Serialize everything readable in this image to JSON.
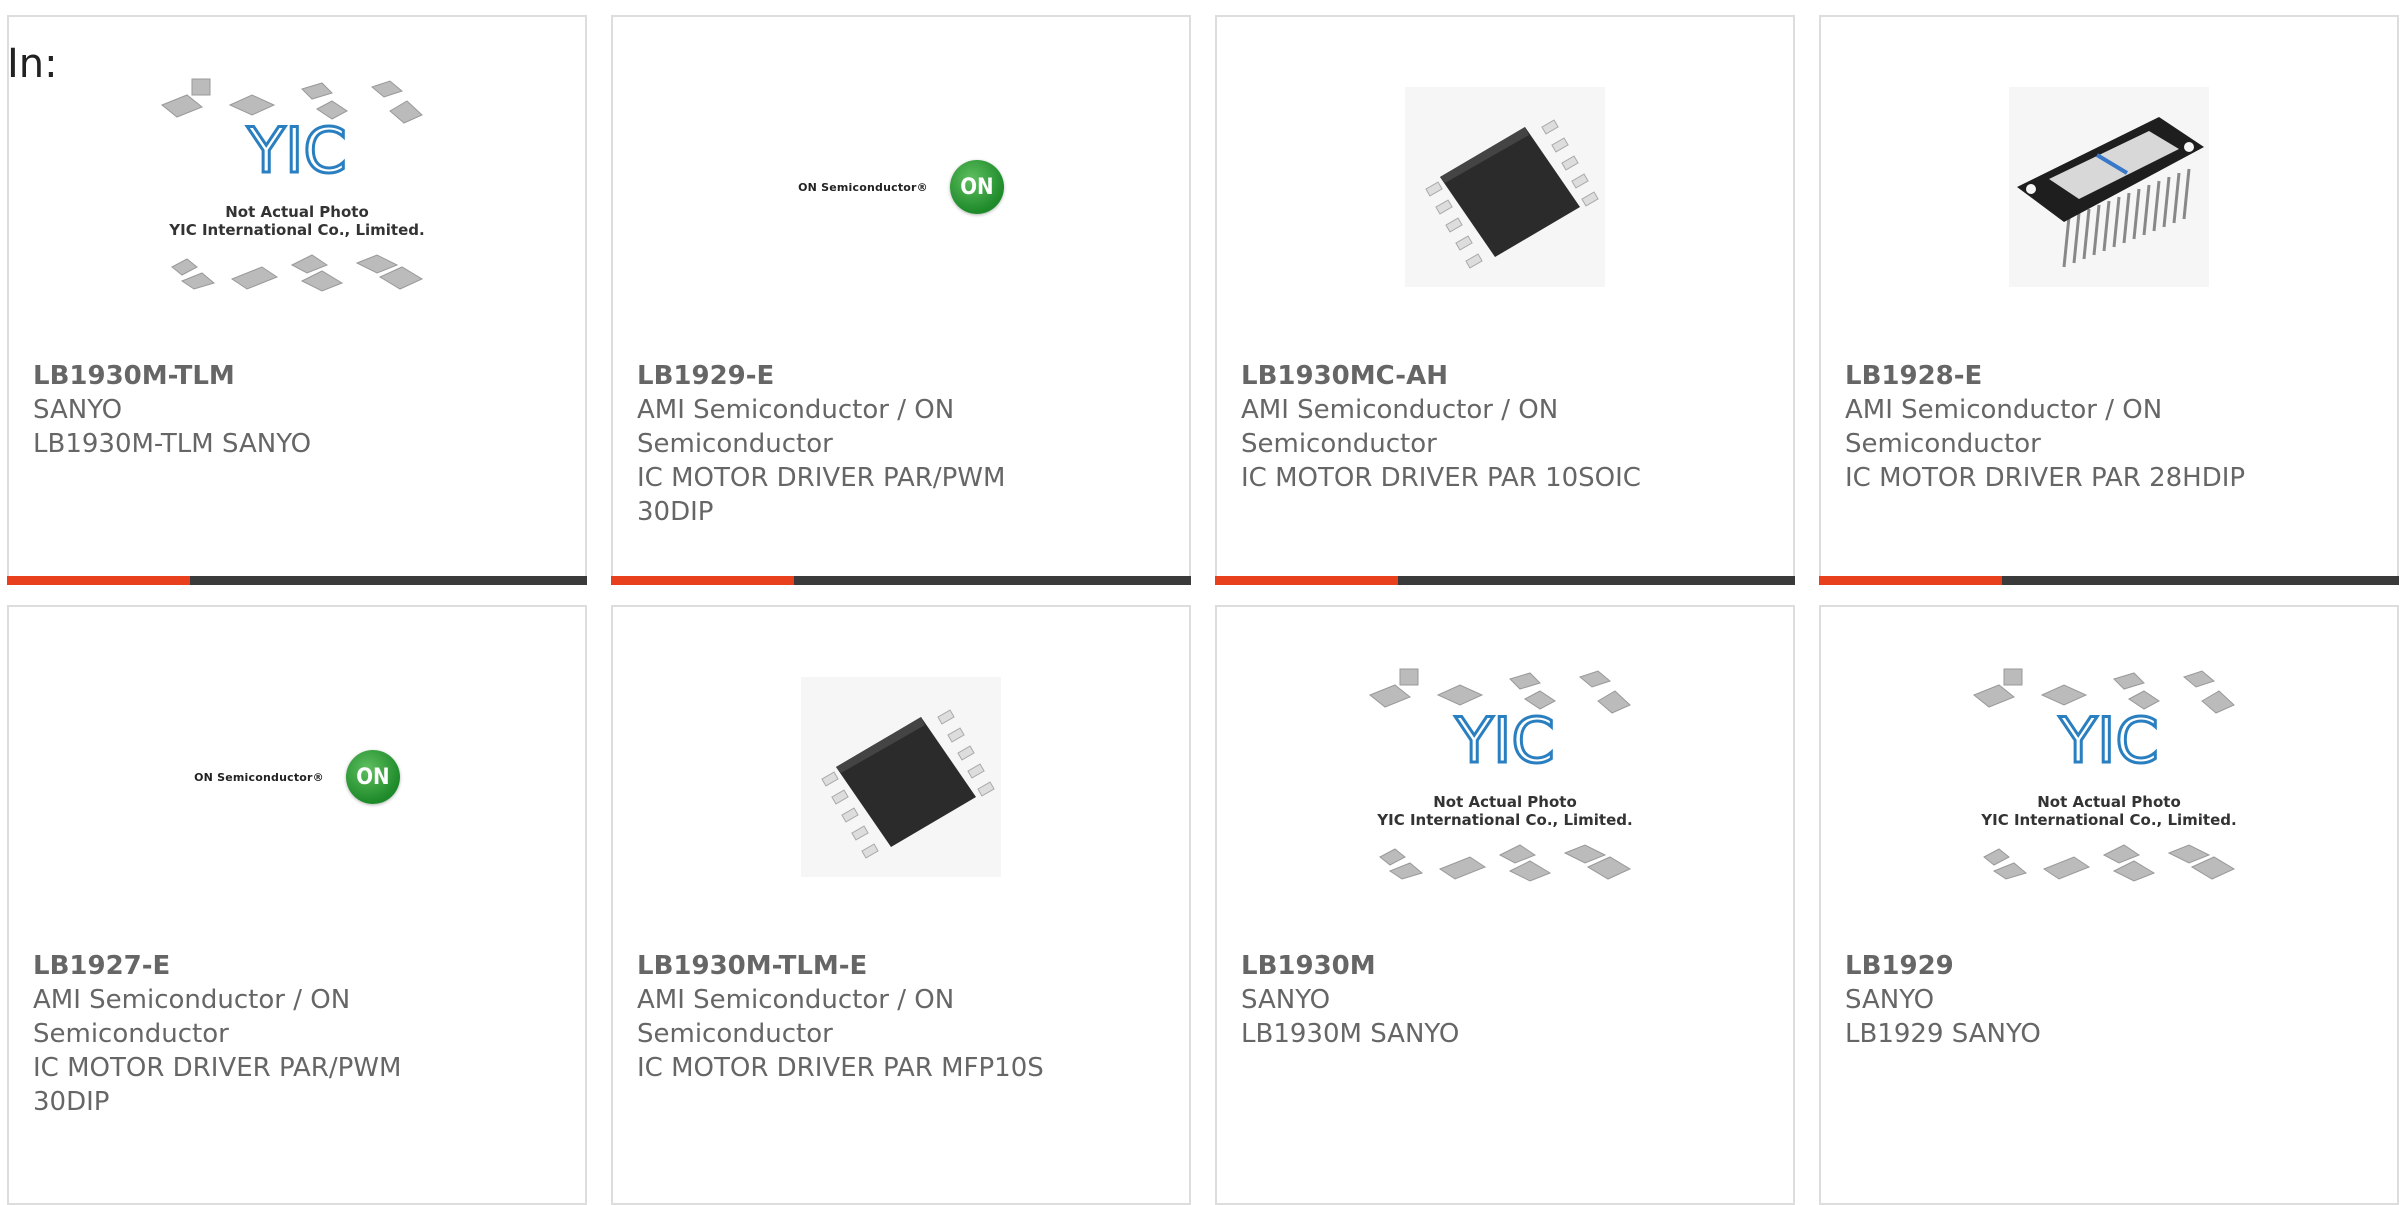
{
  "header": {
    "label": "In:"
  },
  "products": [
    {
      "part": "LB1930M-TLM",
      "manufacturer": "SANYO",
      "description": "LB1930M-TLM SANYO",
      "image": "yic-placeholder",
      "placeholder_text": [
        "Not Actual Photo",
        "YIC International Co., Limited."
      ]
    },
    {
      "part": "LB1929-E",
      "manufacturer": "AMI Semiconductor / ON Semiconductor",
      "description": "IC MOTOR DRIVER PAR/PWM 30DIP",
      "image": "on-semi-logo",
      "logo_text": "ON Semiconductor®",
      "logo_mark": "ON"
    },
    {
      "part": "LB1930MC-AH",
      "manufacturer": "AMI Semiconductor / ON Semiconductor",
      "description": "IC MOTOR DRIVER PAR 10SOIC",
      "image": "soic-chip"
    },
    {
      "part": "LB1928-E",
      "manufacturer": "AMI Semiconductor / ON Semiconductor",
      "description": "IC MOTOR DRIVER PAR 28HDIP",
      "image": "hdip-chip"
    },
    {
      "part": "LB1927-E",
      "manufacturer": "AMI Semiconductor / ON Semiconductor",
      "description": "IC MOTOR DRIVER PAR/PWM 30DIP",
      "image": "on-semi-logo",
      "logo_text": "ON Semiconductor®",
      "logo_mark": "ON"
    },
    {
      "part": "LB1930M-TLM-E",
      "manufacturer": "AMI Semiconductor / ON Semiconductor",
      "description": "IC MOTOR DRIVER PAR MFP10S",
      "image": "soic-chip"
    },
    {
      "part": "LB1930M",
      "manufacturer": "SANYO",
      "description": "LB1930M SANYO",
      "image": "yic-placeholder",
      "placeholder_text": [
        "Not Actual Photo",
        "YIC International Co., Limited."
      ]
    },
    {
      "part": "LB1929",
      "manufacturer": "SANYO",
      "description": "LB1929 SANYO",
      "image": "yic-placeholder",
      "placeholder_text": [
        "Not Actual Photo",
        "YIC International Co., Limited."
      ]
    }
  ],
  "colors": {
    "accent": "#e8401c",
    "bar": "#3a3a3a",
    "border": "#dddddd",
    "on_green": "#1e8a2a",
    "yic_blue": "#2a7fc0"
  }
}
